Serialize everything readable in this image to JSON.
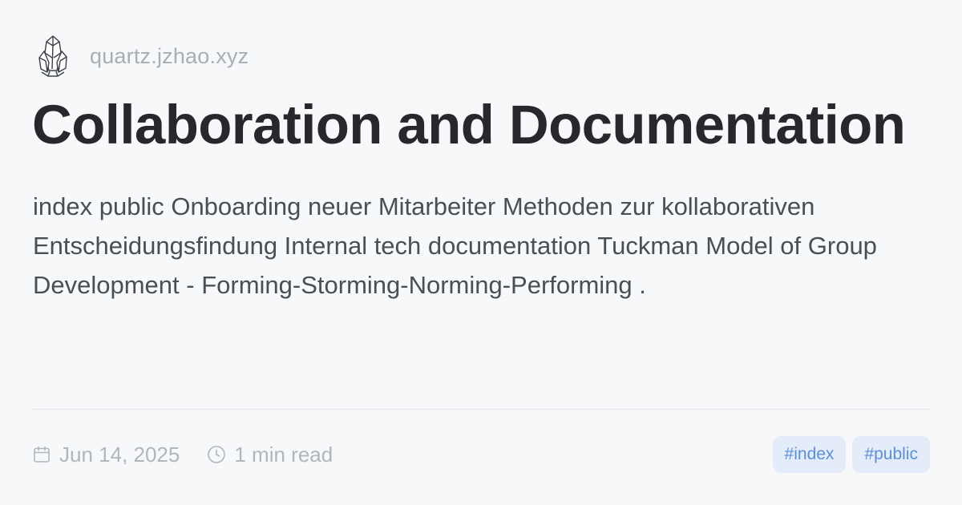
{
  "site": {
    "logo_icon": "crystal-icon",
    "name": "quartz.jzhao.xyz"
  },
  "page": {
    "title": "Collaboration and Documentation",
    "description": "index public Onboarding neuer Mitarbeiter Methoden zur kollaborativen Entscheidungsfindung Internal tech documentation Tuckman Model of Group Development - Forming-Storming-Norming-Performing ."
  },
  "meta": {
    "date_icon": "calendar-icon",
    "date": "Jun 14, 2025",
    "reading_icon": "clock-icon",
    "reading_time": "1 min read"
  },
  "tags": [
    {
      "label": "#index"
    },
    {
      "label": "#public"
    }
  ],
  "colors": {
    "background": "#f7f8fa",
    "title": "#26282b",
    "description": "#4a4e55",
    "muted": "#a9adb4",
    "tag_background": "#e3ecf8",
    "tag_text": "#5b8fd6"
  }
}
